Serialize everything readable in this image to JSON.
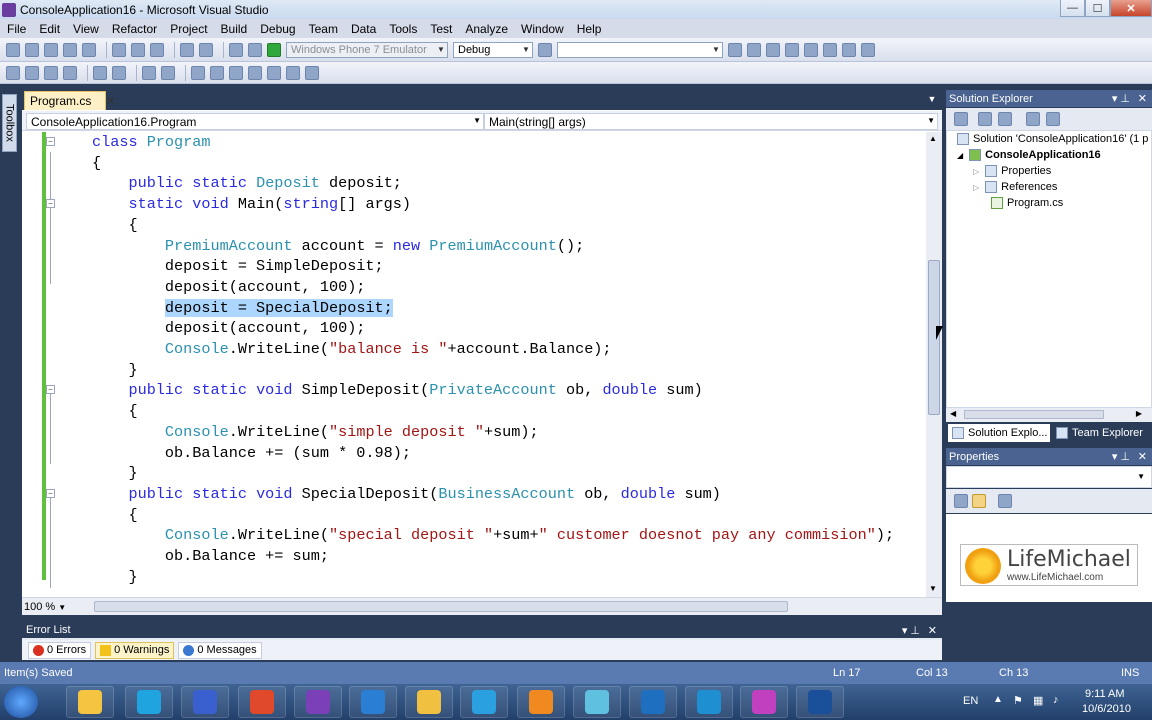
{
  "window": {
    "title": "ConsoleApplication16 - Microsoft Visual Studio",
    "min_glyph": "—",
    "max_glyph": "☐",
    "close_glyph": "✕"
  },
  "menu": [
    "File",
    "Edit",
    "View",
    "Refactor",
    "Project",
    "Build",
    "Debug",
    "Team",
    "Data",
    "Tools",
    "Test",
    "Analyze",
    "Window",
    "Help"
  ],
  "toolbar": {
    "target_device": "Windows Phone 7 Emulator",
    "configuration": "Debug",
    "find_value": ""
  },
  "toolbox_label": "Toolbox",
  "editor": {
    "tab_label": "Program.cs",
    "tab_close": "✕",
    "nav_type": "ConsoleApplication16.Program",
    "nav_member": "Main(string[] args)",
    "zoom": "100 %",
    "lines": [
      [
        {
          "t": "class ",
          "c": "kw"
        },
        {
          "t": "Program",
          "c": "ty"
        }
      ],
      [
        {
          "t": "{",
          "c": ""
        }
      ],
      [
        {
          "t": "    "
        },
        {
          "t": "public static ",
          "c": "kw"
        },
        {
          "t": "Deposit",
          "c": "ty"
        },
        {
          "t": " deposit;"
        }
      ],
      [
        {
          "t": "    "
        },
        {
          "t": "static void ",
          "c": "kw"
        },
        {
          "t": "Main("
        },
        {
          "t": "string",
          "c": "kw"
        },
        {
          "t": "[] args)"
        }
      ],
      [
        {
          "t": "    {"
        }
      ],
      [
        {
          "t": "        "
        },
        {
          "t": "PremiumAccount",
          "c": "ty"
        },
        {
          "t": " account = "
        },
        {
          "t": "new ",
          "c": "kw"
        },
        {
          "t": "PremiumAccount",
          "c": "ty"
        },
        {
          "t": "();"
        }
      ],
      [
        {
          "t": "        deposit = SimpleDeposit;"
        }
      ],
      [
        {
          "t": "        deposit(account, 100);"
        }
      ],
      [
        {
          "t": "        "
        },
        {
          "t": "deposit = SpecialDeposit;",
          "c": "hl"
        }
      ],
      [
        {
          "t": "        deposit(account, 100);"
        }
      ],
      [
        {
          "t": "        "
        },
        {
          "t": "Console",
          "c": "ty"
        },
        {
          "t": ".WriteLine("
        },
        {
          "t": "\"balance is \"",
          "c": "st"
        },
        {
          "t": "+account.Balance);"
        }
      ],
      [
        {
          "t": "    }"
        }
      ],
      [
        {
          "t": "    "
        },
        {
          "t": "public static void ",
          "c": "kw"
        },
        {
          "t": "SimpleDeposit("
        },
        {
          "t": "PrivateAccount",
          "c": "ty"
        },
        {
          "t": " ob, "
        },
        {
          "t": "double",
          "c": "kw"
        },
        {
          "t": " sum)"
        }
      ],
      [
        {
          "t": "    {"
        }
      ],
      [
        {
          "t": "        "
        },
        {
          "t": "Console",
          "c": "ty"
        },
        {
          "t": ".WriteLine("
        },
        {
          "t": "\"simple deposit \"",
          "c": "st"
        },
        {
          "t": "+sum);"
        }
      ],
      [
        {
          "t": "        ob.Balance += (sum * 0.98);"
        }
      ],
      [
        {
          "t": "    }"
        }
      ],
      [
        {
          "t": "    "
        },
        {
          "t": "public static void ",
          "c": "kw"
        },
        {
          "t": "SpecialDeposit("
        },
        {
          "t": "BusinessAccount",
          "c": "ty"
        },
        {
          "t": " ob, "
        },
        {
          "t": "double",
          "c": "kw"
        },
        {
          "t": " sum)"
        }
      ],
      [
        {
          "t": "    {"
        }
      ],
      [
        {
          "t": "        "
        },
        {
          "t": "Console",
          "c": "ty"
        },
        {
          "t": ".WriteLine("
        },
        {
          "t": "\"special deposit \"",
          "c": "st"
        },
        {
          "t": "+sum+"
        },
        {
          "t": "\" customer doesnot pay any commision\"",
          "c": "st"
        },
        {
          "t": ");"
        }
      ],
      [
        {
          "t": "        ob.Balance += sum;"
        }
      ],
      [
        {
          "t": "    }"
        }
      ]
    ]
  },
  "error_list": {
    "title": "Error List",
    "errors": "0 Errors",
    "warnings": "0 Warnings",
    "messages": "0 Messages"
  },
  "status": {
    "message": "Item(s) Saved",
    "ln": "Ln 17",
    "col": "Col 13",
    "ch": "Ch 13",
    "mode": "INS"
  },
  "solution_explorer": {
    "title": "Solution Explorer",
    "solution": "Solution 'ConsoleApplication16' (1 p",
    "project": "ConsoleApplication16",
    "items": [
      "Properties",
      "References",
      "Program.cs"
    ],
    "tab_solution": "Solution Explo...",
    "tab_team": "Team Explorer"
  },
  "properties": {
    "title": "Properties",
    "logo_name": "LifeMichael",
    "logo_url": "www.LifeMichael.com"
  },
  "taskbar": {
    "lang": "EN",
    "time": "9:11 AM",
    "date": "10/6/2010",
    "colors": [
      "#f5c542",
      "#1fa4e0",
      "#3a5fcf",
      "#e04a2a",
      "#7b3fb8",
      "#2a7fd4",
      "#f0c040",
      "#2aa0e0",
      "#f08a20",
      "#60c0e0",
      "#1e6fc0",
      "#1e8fd0",
      "#c040c0",
      "#1a4f9a"
    ]
  }
}
